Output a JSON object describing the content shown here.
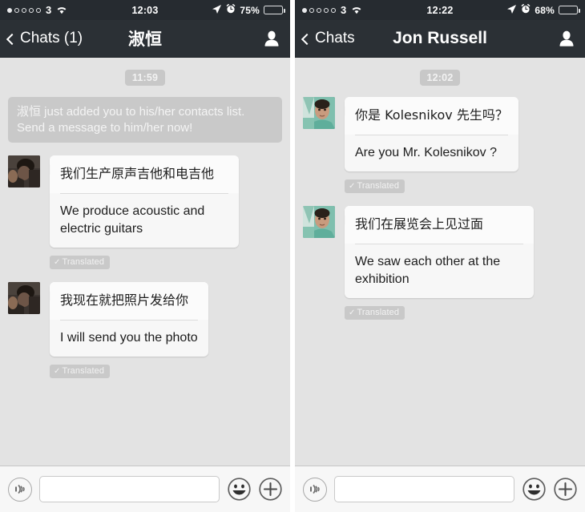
{
  "left": {
    "statusbar": {
      "signal_dots_filled": 1,
      "signal_dots_total": 5,
      "carrier": "3",
      "wifi_icon": "wifi-icon",
      "time": "12:03",
      "location_icon": "location-arrow-icon",
      "alarm_icon": "alarm-clock-icon",
      "battery_percent": "75%",
      "battery_level": 75
    },
    "navbar": {
      "back_label": "Chats (1)",
      "back_icon": "chevron-left-icon",
      "title": "淑恒",
      "contact_icon": "contact-person-icon"
    },
    "conversation": {
      "timestamp": "11:59",
      "system_note_name": "淑恒",
      "system_note_rest": " just added you to his/her contacts list. Send a message to him/her now!",
      "messages": [
        {
          "avatar": "avatar-shuheng",
          "original": "我们生产原声吉他和电吉他",
          "translation": "We produce acoustic and electric guitars",
          "badge": "Translated",
          "badge_check": "✓"
        },
        {
          "avatar": "avatar-shuheng",
          "original": "我现在就把照片发给你",
          "translation": "I will send you the photo",
          "badge": "Translated",
          "badge_check": "✓"
        }
      ]
    },
    "inputbar": {
      "voice_icon": "voice-message-icon",
      "input_value": "",
      "input_placeholder": "",
      "emoji_icon": "smiley-face-icon",
      "plus_icon": "plus-icon"
    }
  },
  "right": {
    "statusbar": {
      "signal_dots_filled": 1,
      "signal_dots_total": 5,
      "carrier": "3",
      "wifi_icon": "wifi-icon",
      "time": "12:22",
      "location_icon": "location-arrow-icon",
      "alarm_icon": "alarm-clock-icon",
      "battery_percent": "68%",
      "battery_level": 68
    },
    "navbar": {
      "back_label": "Chats",
      "back_icon": "chevron-left-icon",
      "title": "Jon Russell",
      "contact_icon": "contact-person-icon"
    },
    "conversation": {
      "timestamp": "12:02",
      "messages": [
        {
          "avatar": "avatar-jon-russell",
          "original": "你是 Kolesnikov 先生吗？",
          "translation": "Are you Mr. Kolesnikov ?",
          "badge": "Translated",
          "badge_check": "✓"
        },
        {
          "avatar": "avatar-jon-russell",
          "original": "我们在展览会上见过面",
          "translation": "We saw each other at the exhibition",
          "badge": "Translated",
          "badge_check": "✓"
        }
      ]
    },
    "inputbar": {
      "voice_icon": "voice-message-icon",
      "input_value": "",
      "input_placeholder": "",
      "emoji_icon": "smiley-face-icon",
      "plus_icon": "plus-icon"
    }
  },
  "colors": {
    "statusbar_bg": "#262b30",
    "navbar_bg": "#2b3035",
    "chat_bg": "#e3e3e3",
    "bubble_bg": "#f7f7f7",
    "badge_bg": "#c9c9c9",
    "inputbar_bg": "#f7f7f7"
  }
}
